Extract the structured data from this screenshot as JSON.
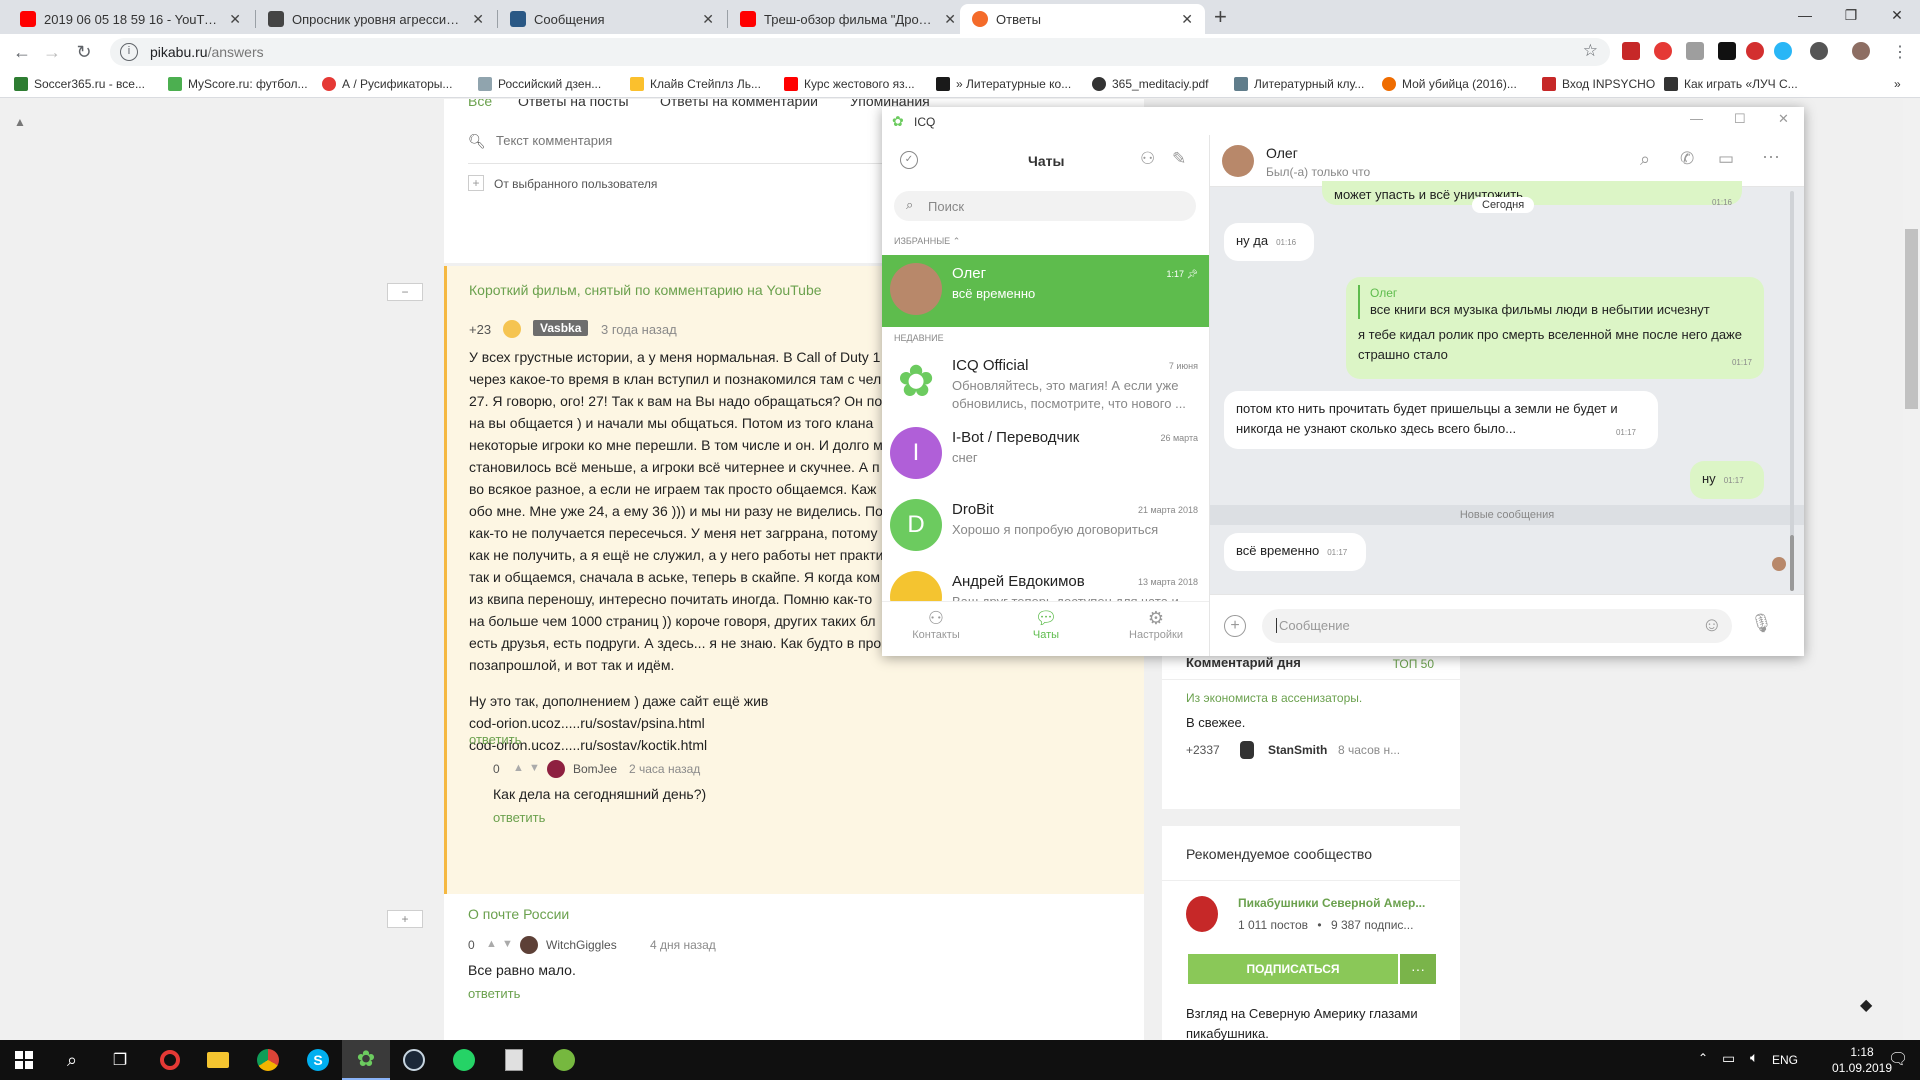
{
  "browser": {
    "tabs": [
      {
        "title": "2019 06 05 18 59 16 - YouTube",
        "icon_color": "#ff0000"
      },
      {
        "title": "Опросник уровня агрессивност",
        "icon_color": "#333333"
      },
      {
        "title": "Сообщения",
        "icon_color": "#2a5885"
      },
      {
        "title": "Треш-обзор фильма \"Дрожь Зе",
        "icon_color": "#ff0000"
      },
      {
        "title": "Ответы",
        "icon_color": "#f46b2a",
        "active": true
      }
    ],
    "new_tab": "+",
    "url_host": "pikabu.ru",
    "url_path": "/answers",
    "bookmarks": [
      {
        "label": "Soccer365.ru - все...",
        "color": "#2e7d32"
      },
      {
        "label": "MyScore.ru: футбол...",
        "color": "#4caf50"
      },
      {
        "label": "А / Русификаторы...",
        "color": "#e53935"
      },
      {
        "label": "Российский дзен...",
        "color": "#90a4ae"
      },
      {
        "label": "Клайв Стейплз Ль...",
        "color": "#fbc02d"
      },
      {
        "label": "Курс жестового яз...",
        "color": "#ff0000"
      },
      {
        "label": "» Литературные ко...",
        "color": "#1a1a1a"
      },
      {
        "label": "365_meditaciy.pdf",
        "color": "#333333"
      },
      {
        "label": "Литературный клу...",
        "color": "#607d8b"
      },
      {
        "label": "Мой убийца (2016)...",
        "color": "#ef6c00"
      },
      {
        "label": "Вход INPSYCHO",
        "color": "#c62828"
      },
      {
        "label": "Как играть «ЛУЧ С...",
        "color": "#333333"
      }
    ],
    "more": "»"
  },
  "pikabu": {
    "tabs": [
      "Все",
      "Ответы на посты",
      "Ответы на комментарии",
      "Упоминания"
    ],
    "comment_placeholder": "Текст комментария",
    "from_user": "От выбранного пользователя",
    "answer1": {
      "collapse": "−",
      "post_title": "Короткий фильм, снятый по комментарию на YouTube",
      "rating": "+23",
      "author": "Vasbka",
      "time": "3 года назад",
      "lines": [
        "У всех грустные истории, а у меня нормальная. В Call of Duty 1",
        "через какое-то время в клан вступил и познакомился там с чел",
        "27. Я говорю, ого! 27! Так к вам на Вы надо обращаться? Он по",
        "на вы общается ) и начали мы общаться. Потом из того клана",
        "некоторые игроки ко мне перешли. В том числе и он. И долго м",
        "становилось всё меньше, а игроки всё читернее и скучнее. А п",
        "во всякое разное, а если не играем так просто общаемся. Каж",
        "обо мне. Мне уже 24, а ему 36 ))) и мы ни разу не виделись. По",
        "как-то не получается пересечься. У меня нет загрpана, потому ч",
        "как не получить, а я ещё не служил, а у него работы нет практи",
        "так и общаемся, сначала в аське, теперь в скайпе. Я когда ком",
        "из квипа переношу, интересно почитать иногда. Помню как-то",
        "на больше чем 1000 страниц )) короче говоря, других таких бл",
        "есть друзья, есть подруги. А здесь... я не знаю. Как будто в про",
        "позапрошлой, и вот так и идём."
      ],
      "extra_lines": [
        "Ну это так, дополнением ) даже сайт ещё жив",
        "cod-orion.ucoz.....ru/sostav/psina.html",
        "cod-orion.ucoz.....ru/sostav/koctik.html"
      ],
      "reply": "ответить",
      "sub": {
        "rating": "0",
        "author": "BomJee",
        "time": "2 часа назад",
        "text": "Как дела на сегодняшний день?)",
        "reply": "ответить"
      }
    },
    "answer2": {
      "expand": "+",
      "post_title": "О почте России",
      "rating": "0",
      "author": "WitchGiggles",
      "time": "4 дня назад",
      "text": "Все равно мало.",
      "reply": "ответить"
    },
    "sidebar": {
      "comment_day": "Комментарий дня",
      "top50": "ТОП 50",
      "cd_title": "Из экономиста в ассенизаторы.",
      "cd_text": "В свежее.",
      "cd_rating": "+2337",
      "cd_author": "StanSmith",
      "cd_time": "8 часов н...",
      "rec_title": "Рекомендуемое сообщество",
      "community": "Пикабушники Северной Амер...",
      "posts": "1 011 постов",
      "dot": "•",
      "subs": "9 387 подпис...",
      "subscribe": "ПОДПИСАТЬСЯ",
      "more": "···",
      "desc1": "Взгляд на Северную Америку глазами",
      "desc2": "пикабушника."
    }
  },
  "icq": {
    "app_name": "ICQ",
    "chats_title": "Чаты",
    "search_placeholder": "Поиск",
    "favorites_label": "ИЗБРАННЫЕ",
    "recent_label": "НЕДАВНИЕ",
    "contacts": [
      {
        "name": "Олег",
        "msg": "всё временно",
        "time": "1:17",
        "selected": true
      },
      {
        "name": "ICQ Official",
        "msg": "Обновляйтесь, это магия! А если уже обновились, посмотрите, что нового ...",
        "time": "7 июня"
      },
      {
        "name": "I-Bot / Переводчик",
        "msg": "снег",
        "time": "26 марта",
        "avatar_letter": "I",
        "avatar_color": "#b05fd8"
      },
      {
        "name": "DroBit",
        "msg": "Хорошо я попробую договориться",
        "time": "21 марта 2018",
        "avatar_letter": "D",
        "avatar_color": "#6ccb5f"
      },
      {
        "name": "Андрей Евдокимов",
        "msg": "Ваш друг теперь доступен для чата и...",
        "time": "13 марта 2018"
      }
    ],
    "bottom_nav": [
      "Контакты",
      "Чаты",
      "Настройки"
    ],
    "chat": {
      "name": "Олег",
      "status": "Был(-а) только что",
      "top_partial": "может упасть и всё уничтожить",
      "top_partial_time": "01:16",
      "today": "Сегодня",
      "messages": [
        {
          "text": "ну да",
          "time": "01:16",
          "dir": "in"
        },
        {
          "quote_author": "Олег",
          "quote": "все книги вся музыка фильмы люди в небытии исчезнут",
          "text": "я тебе кидал ролик про смерть вселенной мне после него даже страшно стало",
          "time": "01:17",
          "dir": "out"
        },
        {
          "text": "потом кто нить прочитать будет пришельцы а земли не будет и никогда не узнают сколько здесь всего было...",
          "time": "01:17",
          "dir": "in"
        },
        {
          "text": "ну",
          "time": "01:17",
          "dir": "out"
        }
      ],
      "new_messages": "Новые сообщения",
      "last": {
        "text": "всё временно",
        "time": "01:17"
      },
      "input_placeholder": "Сообщение"
    }
  },
  "taskbar": {
    "lang": "ENG",
    "time": "1:18",
    "date": "01.09.2019"
  }
}
